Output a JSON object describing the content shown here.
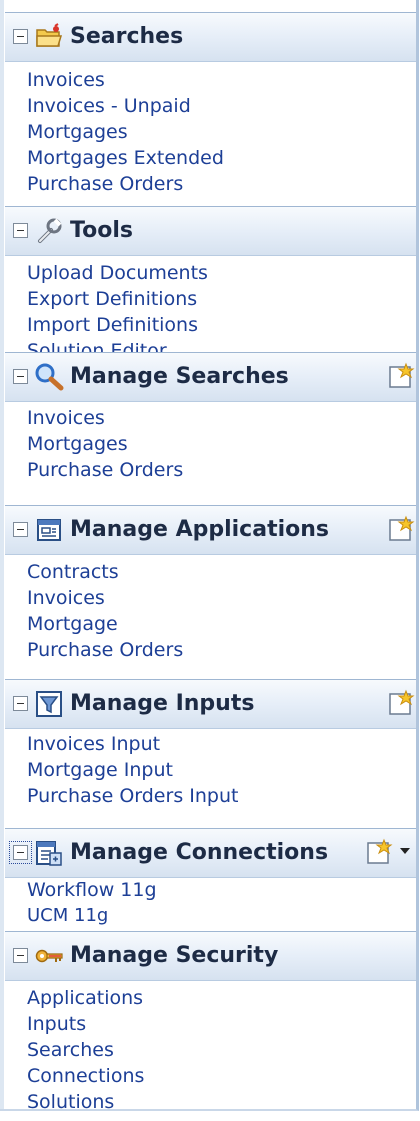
{
  "sections": [
    {
      "title": "Searches",
      "icon": "folder-icon",
      "links": [
        "Invoices",
        "Invoices - Unpaid",
        "Mortgages",
        "Mortgages Extended",
        "Purchase Orders"
      ]
    },
    {
      "title": "Tools",
      "icon": "wrench-icon",
      "links": [
        "Upload Documents",
        "Export Definitions",
        "Import Definitions",
        "Solution Editor"
      ]
    },
    {
      "title": "Manage Searches",
      "icon": "magnifier-icon",
      "new_button": true,
      "links": [
        "Invoices",
        "Mortgages",
        "Purchase Orders"
      ]
    },
    {
      "title": "Manage Applications",
      "icon": "application-icon",
      "new_button": true,
      "links": [
        "Contracts",
        "Invoices",
        "Mortgage",
        "Purchase Orders"
      ]
    },
    {
      "title": "Manage Inputs",
      "icon": "funnel-icon",
      "new_button": true,
      "links": [
        "Invoices Input",
        "Mortgage Input",
        "Purchase Orders Input"
      ]
    },
    {
      "title": "Manage Connections",
      "icon": "connection-icon",
      "new_button": true,
      "dropdown": true,
      "links": [
        "Workflow 11g",
        "UCM 11g"
      ]
    },
    {
      "title": "Manage Security",
      "icon": "key-icon",
      "links": [
        "Applications",
        "Inputs",
        "Searches",
        "Connections",
        "Solutions"
      ]
    }
  ],
  "colors": {
    "link": "#1d3f96",
    "header_text": "#1d2b45",
    "header_gradient_top": "#f7fafd",
    "header_gradient_bottom": "#d6e2f0",
    "header_border": "#9fb6d2"
  }
}
